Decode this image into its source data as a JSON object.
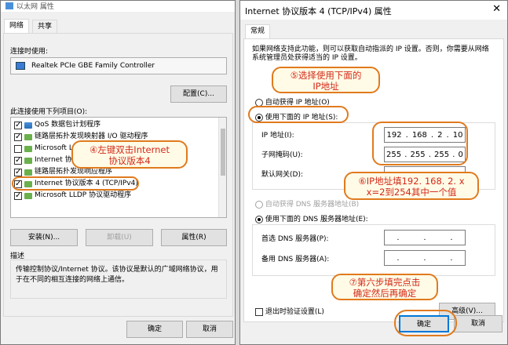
{
  "left": {
    "title": "以太网 属性",
    "tabs": [
      "网络",
      "共享"
    ],
    "connect_using_label": "连接时使用:",
    "adapter_name": "Realtek PCIe GBE Family Controller",
    "configure_button": "配置(C)...",
    "items_label": "此连接使用下列项目(O):",
    "items": [
      {
        "text": "QoS 数据包计划程序",
        "checked": true
      },
      {
        "text": "链路层拓扑发现映射器 I/O 驱动程序",
        "checked": true
      },
      {
        "text": "Microsoft L",
        "checked": false
      },
      {
        "text": "Internet 协",
        "checked": true
      },
      {
        "text": "链路层拓扑发现响应程序",
        "checked": true
      },
      {
        "text": "Internet 协议版本 4 (TCP/IPv4)",
        "checked": true
      },
      {
        "text": "Microsoft LLDP 协议驱动程序",
        "checked": true
      }
    ],
    "install_button": "安装(N)...",
    "uninstall_button": "卸载(U)",
    "properties_button": "属性(R)",
    "description_label": "描述",
    "description_text": "传输控制协议/Internet 协议。该协议是默认的广域网络协议，用于在不同的相互连接的网络上通信。",
    "ok_button": "确定",
    "cancel_button": "取消"
  },
  "right": {
    "title": "Internet 协议版本 4 (TCP/IPv4) 属性",
    "close_icon": "✕",
    "tab": "常规",
    "intro_text": "如果网络支持此功能，则可以获取自动指派的 IP 设置。否则，你需要从网络系统管理员处获得适当的 IP 设置。",
    "auto_ip_label": "自动获得 IP 地址(O)",
    "use_ip_label": "使用下面的 IP 地址(S):",
    "ip_label": "IP 地址(I):",
    "ip_value": [
      "192",
      "168",
      "2",
      "10"
    ],
    "mask_label": "子网掩码(U):",
    "mask_value": [
      "255",
      "255",
      "255",
      "0"
    ],
    "gateway_label": "默认网关(D):",
    "auto_dns_label": "自动获得 DNS 服务器地址(B)",
    "use_dns_label": "使用下面的 DNS 服务器地址(E):",
    "dns1_label": "首选 DNS 服务器(P):",
    "dns2_label": "备用 DNS 服务器(A):",
    "validate_label": "退出时验证设置(L)",
    "advanced_button": "高级(V)...",
    "ok_button": "确定",
    "cancel_button": "取消"
  },
  "callouts": {
    "c4": "④左键双击Internet\n协议版本4",
    "c5": "⑤选择使用下面的\nIP地址",
    "c6": "⑥IP地址填192. 168. 2. x\nx=2到254其中一个值",
    "c7": "⑦第六步填完点击\n确定然后再确定"
  },
  "colors": {
    "accent": "#0078d7",
    "callout_border": "#e07a1e",
    "callout_text": "#d42a1a"
  }
}
